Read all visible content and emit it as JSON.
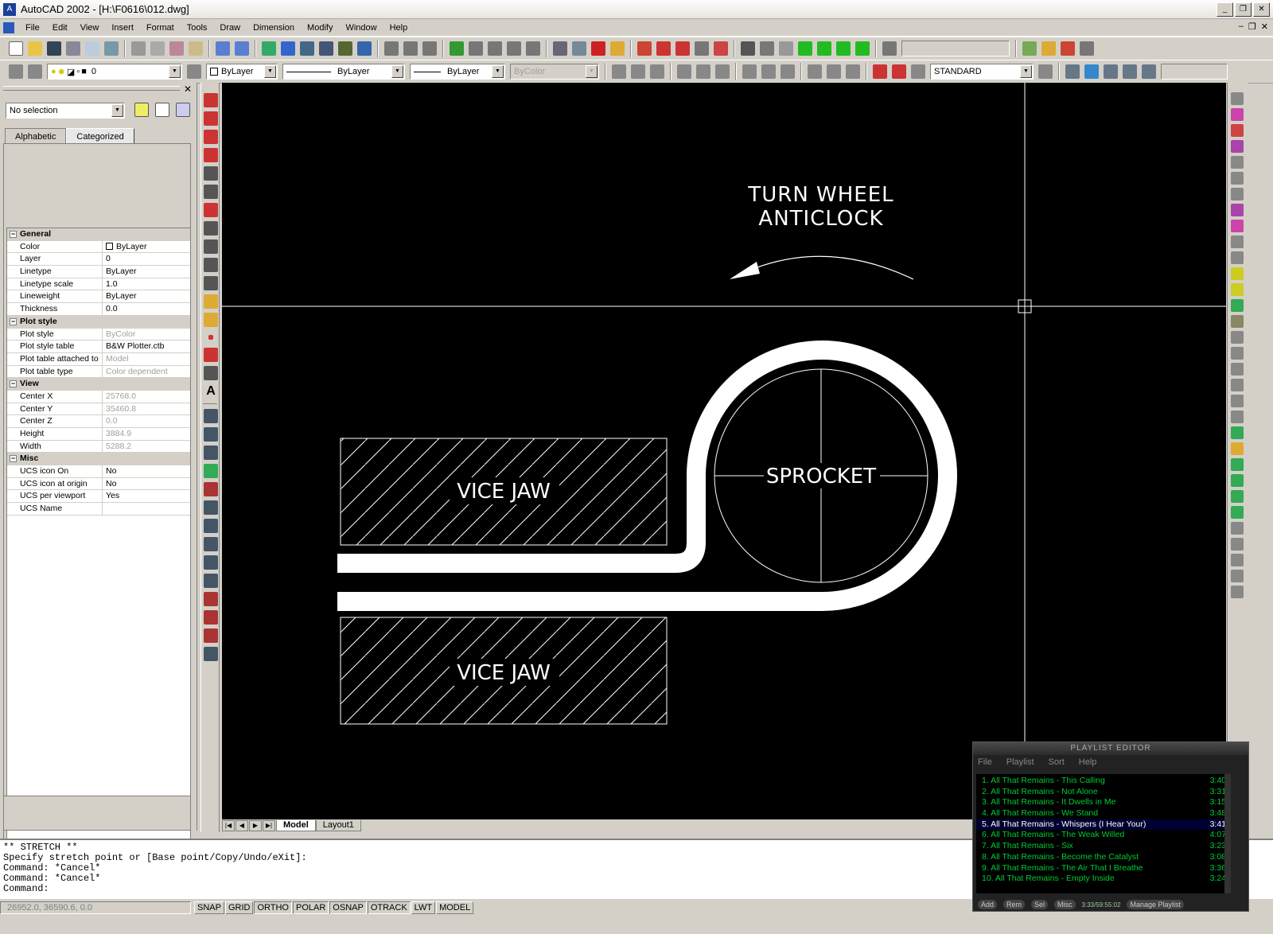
{
  "window": {
    "title": "AutoCAD 2002 - [H:\\F0616\\012.dwg]"
  },
  "menu": [
    "File",
    "Edit",
    "View",
    "Insert",
    "Format",
    "Tools",
    "Draw",
    "Dimension",
    "Modify",
    "Window",
    "Help"
  ],
  "layer_toolbar": {
    "layer_value": "0",
    "color_value": "ByLayer",
    "linetype_value": "ByLayer",
    "lineweight_value": "ByLayer",
    "plotstyle_value": "ByColor",
    "textstyle_value": "STANDARD"
  },
  "properties": {
    "selection": "No selection",
    "tabs": [
      "Alphabetic",
      "Categorized"
    ],
    "rows": [
      {
        "cat": true,
        "k": "General"
      },
      {
        "k": "Color",
        "v": "ByLayer"
      },
      {
        "k": "Layer",
        "v": "0"
      },
      {
        "k": "Linetype",
        "v": "ByLayer"
      },
      {
        "k": "Linetype scale",
        "v": "1.0"
      },
      {
        "k": "Lineweight",
        "v": "ByLayer"
      },
      {
        "k": "Thickness",
        "v": "0.0"
      },
      {
        "cat": true,
        "k": "Plot style"
      },
      {
        "k": "Plot style",
        "v": "ByColor",
        "dim": true
      },
      {
        "k": "Plot style table",
        "v": "B&W Plotter.ctb"
      },
      {
        "k": "Plot table attached to",
        "v": "Model",
        "dim": true
      },
      {
        "k": "Plot table type",
        "v": "Color dependent",
        "dim": true
      },
      {
        "cat": true,
        "k": "View"
      },
      {
        "k": "Center X",
        "v": "25768.0",
        "dim": true
      },
      {
        "k": "Center Y",
        "v": "35460.8",
        "dim": true
      },
      {
        "k": "Center Z",
        "v": "0.0",
        "dim": true
      },
      {
        "k": "Height",
        "v": "3884.9",
        "dim": true
      },
      {
        "k": "Width",
        "v": "5288.2",
        "dim": true
      },
      {
        "cat": true,
        "k": "Misc"
      },
      {
        "k": "UCS icon On",
        "v": "No"
      },
      {
        "k": "UCS icon at origin",
        "v": "No"
      },
      {
        "k": "UCS per viewport",
        "v": "Yes"
      },
      {
        "k": "UCS Name",
        "v": ""
      }
    ]
  },
  "drawing": {
    "text_turn": "TURN  WHEEL",
    "text_anticlock": "ANTICLOCK",
    "vice_jaw_top": "VICE  JAW",
    "vice_jaw_bottom": "VICE  JAW",
    "sprocket": "SPROCKET"
  },
  "layout_tabs": [
    "Model",
    "Layout1"
  ],
  "command_lines": [
    "** STRETCH **",
    "Specify stretch point or [Base point/Copy/Undo/eXit]:",
    "Command: *Cancel*",
    "Command: *Cancel*",
    "Command:"
  ],
  "status": {
    "coords": "26952.0, 36590.6, 0.0",
    "buttons": [
      "SNAP",
      "GRID",
      "ORTHO",
      "POLAR",
      "OSNAP",
      "OTRACK",
      "LWT",
      "MODEL"
    ]
  },
  "playlist": {
    "title": "PLAYLIST EDITOR",
    "menu": [
      "File",
      "Playlist",
      "Sort",
      "Help"
    ],
    "tracks": [
      {
        "name": "1. All That Remains - This Calling",
        "time": "3:40"
      },
      {
        "name": "2. All That Remains - Not Alone",
        "time": "3:31"
      },
      {
        "name": "3. All That Remains - It Dwells in Me",
        "time": "3:15"
      },
      {
        "name": "4. All That Remains - We Stand",
        "time": "3:48"
      },
      {
        "name": "5. All That Remains - Whispers (I Hear Your)",
        "time": "3:41"
      },
      {
        "name": "6. All That Remains - The Weak Willed",
        "time": "4:07"
      },
      {
        "name": "7. All That Remains - Six",
        "time": "3:23"
      },
      {
        "name": "8. All That Remains - Become the Catalyst",
        "time": "3:08"
      },
      {
        "name": "9. All That Remains - The Air That I Breathe",
        "time": "3:36"
      },
      {
        "name": "10. All That Remains - Empty Inside",
        "time": "3:24"
      }
    ],
    "buttons": [
      "Add",
      "Rem",
      "Sel",
      "Misc"
    ],
    "time_total": "3:33/59:55:02",
    "manage": "Manage Playlist"
  }
}
